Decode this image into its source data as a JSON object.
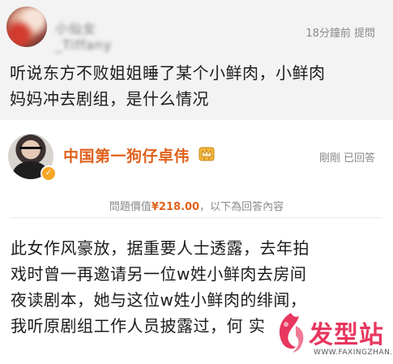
{
  "question": {
    "asker_name": "小仙女_Tiffany",
    "meta": "18分鐘前 提問",
    "text_lines": [
      "听说东方不败姐姐睡了某个小鲜肉，小鲜肉",
      "妈妈冲去剧组，是什么情况"
    ]
  },
  "answer": {
    "name": "中国第一狗仔卓伟",
    "meta": "剛剛 已回答",
    "price_prefix": "問題價值",
    "price": "¥218.00",
    "price_suffix": "，以下為回答內容",
    "text_lines": [
      "此女作风豪放，据重要人士透露，去年拍",
      "戏时曾一再邀请另一位w姓小鲜肉去房间",
      "夜读剧本，她与这位w姓小鲜肉的绯闻，",
      "我听原剧组工作人员披露过，何 实"
    ]
  },
  "watermark": {
    "text": "发型站",
    "url": "WWW.FAXINGZHAN.COM"
  },
  "colors": {
    "accent": "#e0611c",
    "watermark": "#e8365e",
    "question_bg": "#f3f3f3"
  }
}
